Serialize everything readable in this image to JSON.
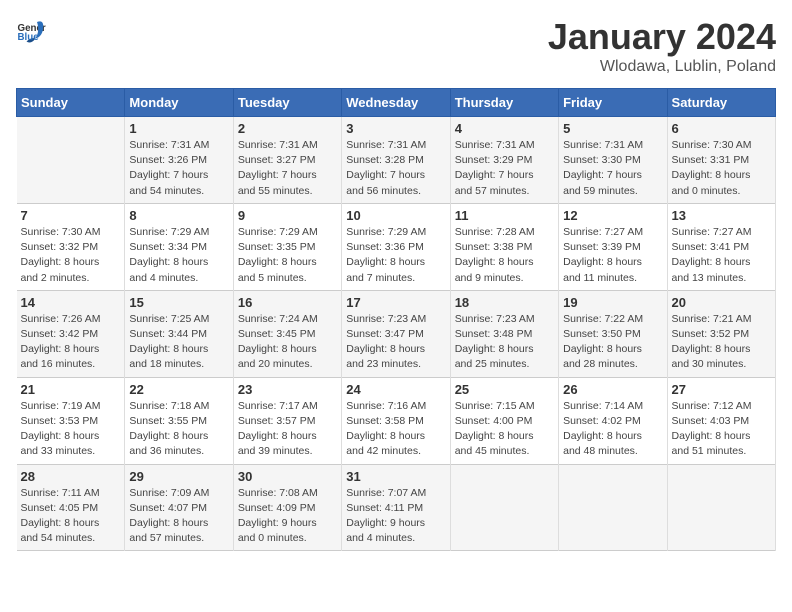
{
  "header": {
    "logo_general": "General",
    "logo_blue": "Blue",
    "title": "January 2024",
    "subtitle": "Wlodawa, Lublin, Poland"
  },
  "calendar": {
    "days_of_week": [
      "Sunday",
      "Monday",
      "Tuesday",
      "Wednesday",
      "Thursday",
      "Friday",
      "Saturday"
    ],
    "weeks": [
      [
        {
          "day": "",
          "info": ""
        },
        {
          "day": "1",
          "info": "Sunrise: 7:31 AM\nSunset: 3:26 PM\nDaylight: 7 hours\nand 54 minutes."
        },
        {
          "day": "2",
          "info": "Sunrise: 7:31 AM\nSunset: 3:27 PM\nDaylight: 7 hours\nand 55 minutes."
        },
        {
          "day": "3",
          "info": "Sunrise: 7:31 AM\nSunset: 3:28 PM\nDaylight: 7 hours\nand 56 minutes."
        },
        {
          "day": "4",
          "info": "Sunrise: 7:31 AM\nSunset: 3:29 PM\nDaylight: 7 hours\nand 57 minutes."
        },
        {
          "day": "5",
          "info": "Sunrise: 7:31 AM\nSunset: 3:30 PM\nDaylight: 7 hours\nand 59 minutes."
        },
        {
          "day": "6",
          "info": "Sunrise: 7:30 AM\nSunset: 3:31 PM\nDaylight: 8 hours\nand 0 minutes."
        }
      ],
      [
        {
          "day": "7",
          "info": "Sunrise: 7:30 AM\nSunset: 3:32 PM\nDaylight: 8 hours\nand 2 minutes."
        },
        {
          "day": "8",
          "info": "Sunrise: 7:29 AM\nSunset: 3:34 PM\nDaylight: 8 hours\nand 4 minutes."
        },
        {
          "day": "9",
          "info": "Sunrise: 7:29 AM\nSunset: 3:35 PM\nDaylight: 8 hours\nand 5 minutes."
        },
        {
          "day": "10",
          "info": "Sunrise: 7:29 AM\nSunset: 3:36 PM\nDaylight: 8 hours\nand 7 minutes."
        },
        {
          "day": "11",
          "info": "Sunrise: 7:28 AM\nSunset: 3:38 PM\nDaylight: 8 hours\nand 9 minutes."
        },
        {
          "day": "12",
          "info": "Sunrise: 7:27 AM\nSunset: 3:39 PM\nDaylight: 8 hours\nand 11 minutes."
        },
        {
          "day": "13",
          "info": "Sunrise: 7:27 AM\nSunset: 3:41 PM\nDaylight: 8 hours\nand 13 minutes."
        }
      ],
      [
        {
          "day": "14",
          "info": "Sunrise: 7:26 AM\nSunset: 3:42 PM\nDaylight: 8 hours\nand 16 minutes."
        },
        {
          "day": "15",
          "info": "Sunrise: 7:25 AM\nSunset: 3:44 PM\nDaylight: 8 hours\nand 18 minutes."
        },
        {
          "day": "16",
          "info": "Sunrise: 7:24 AM\nSunset: 3:45 PM\nDaylight: 8 hours\nand 20 minutes."
        },
        {
          "day": "17",
          "info": "Sunrise: 7:23 AM\nSunset: 3:47 PM\nDaylight: 8 hours\nand 23 minutes."
        },
        {
          "day": "18",
          "info": "Sunrise: 7:23 AM\nSunset: 3:48 PM\nDaylight: 8 hours\nand 25 minutes."
        },
        {
          "day": "19",
          "info": "Sunrise: 7:22 AM\nSunset: 3:50 PM\nDaylight: 8 hours\nand 28 minutes."
        },
        {
          "day": "20",
          "info": "Sunrise: 7:21 AM\nSunset: 3:52 PM\nDaylight: 8 hours\nand 30 minutes."
        }
      ],
      [
        {
          "day": "21",
          "info": "Sunrise: 7:19 AM\nSunset: 3:53 PM\nDaylight: 8 hours\nand 33 minutes."
        },
        {
          "day": "22",
          "info": "Sunrise: 7:18 AM\nSunset: 3:55 PM\nDaylight: 8 hours\nand 36 minutes."
        },
        {
          "day": "23",
          "info": "Sunrise: 7:17 AM\nSunset: 3:57 PM\nDaylight: 8 hours\nand 39 minutes."
        },
        {
          "day": "24",
          "info": "Sunrise: 7:16 AM\nSunset: 3:58 PM\nDaylight: 8 hours\nand 42 minutes."
        },
        {
          "day": "25",
          "info": "Sunrise: 7:15 AM\nSunset: 4:00 PM\nDaylight: 8 hours\nand 45 minutes."
        },
        {
          "day": "26",
          "info": "Sunrise: 7:14 AM\nSunset: 4:02 PM\nDaylight: 8 hours\nand 48 minutes."
        },
        {
          "day": "27",
          "info": "Sunrise: 7:12 AM\nSunset: 4:03 PM\nDaylight: 8 hours\nand 51 minutes."
        }
      ],
      [
        {
          "day": "28",
          "info": "Sunrise: 7:11 AM\nSunset: 4:05 PM\nDaylight: 8 hours\nand 54 minutes."
        },
        {
          "day": "29",
          "info": "Sunrise: 7:09 AM\nSunset: 4:07 PM\nDaylight: 8 hours\nand 57 minutes."
        },
        {
          "day": "30",
          "info": "Sunrise: 7:08 AM\nSunset: 4:09 PM\nDaylight: 9 hours\nand 0 minutes."
        },
        {
          "day": "31",
          "info": "Sunrise: 7:07 AM\nSunset: 4:11 PM\nDaylight: 9 hours\nand 4 minutes."
        },
        {
          "day": "",
          "info": ""
        },
        {
          "day": "",
          "info": ""
        },
        {
          "day": "",
          "info": ""
        }
      ]
    ]
  }
}
